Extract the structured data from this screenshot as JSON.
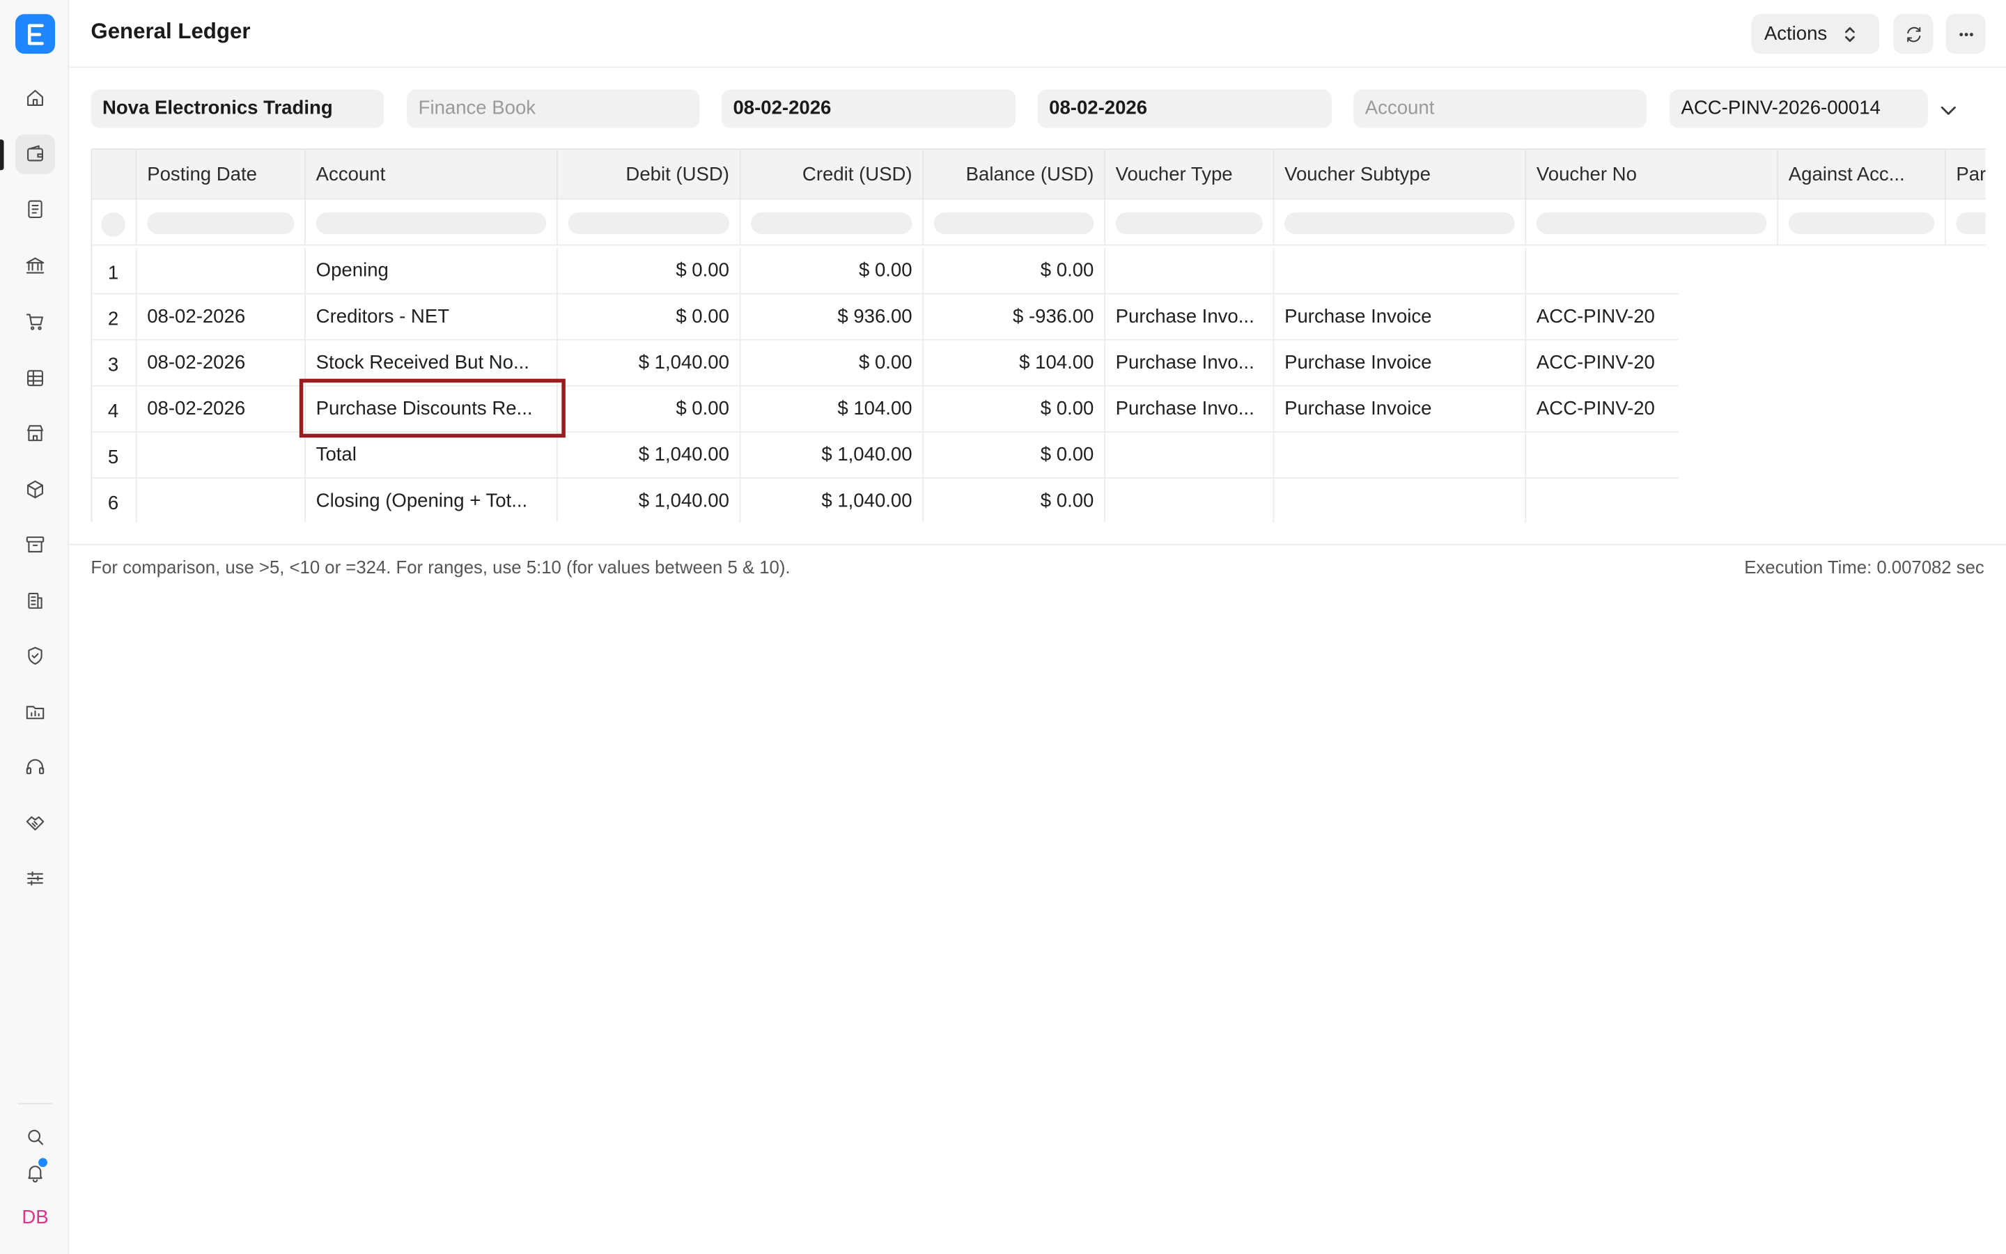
{
  "header": {
    "title": "General Ledger",
    "actions_label": "Actions"
  },
  "filters": {
    "company": "Nova Electronics Trading",
    "finance_book_placeholder": "Finance Book",
    "from_date": "08-02-2026",
    "to_date": "08-02-2026",
    "account_placeholder": "Account",
    "voucher_no": "ACC-PINV-2026-00014"
  },
  "table": {
    "columns": [
      "Posting Date",
      "Account",
      "Debit (USD)",
      "Credit (USD)",
      "Balance (USD)",
      "Voucher Type",
      "Voucher Subtype",
      "Voucher No",
      "Against Acc...",
      "Par"
    ],
    "rows": [
      {
        "idx": "1",
        "posting_date": "",
        "account": "Opening",
        "debit": "$ 0.00",
        "credit": "$ 0.00",
        "balance": "$ 0.00",
        "voucher_type": "",
        "voucher_subtype": "",
        "voucher_no": ""
      },
      {
        "idx": "2",
        "posting_date": "08-02-2026",
        "account": "Creditors - NET",
        "debit": "$ 0.00",
        "credit": "$ 936.00",
        "balance": "$ -936.00",
        "voucher_type": "Purchase Invo...",
        "voucher_subtype": "Purchase Invoice",
        "voucher_no": "ACC-PINV-20"
      },
      {
        "idx": "3",
        "posting_date": "08-02-2026",
        "account": "Stock Received But No...",
        "debit": "$ 1,040.00",
        "credit": "$ 0.00",
        "balance": "$ 104.00",
        "voucher_type": "Purchase Invo...",
        "voucher_subtype": "Purchase Invoice",
        "voucher_no": "ACC-PINV-20"
      },
      {
        "idx": "4",
        "posting_date": "08-02-2026",
        "account": "Purchase Discounts Re...",
        "debit": "$ 0.00",
        "credit": "$ 104.00",
        "balance": "$ 0.00",
        "voucher_type": "Purchase Invo...",
        "voucher_subtype": "Purchase Invoice",
        "voucher_no": "ACC-PINV-20"
      },
      {
        "idx": "5",
        "posting_date": "",
        "account": "Total",
        "debit": "$ 1,040.00",
        "credit": "$ 1,040.00",
        "balance": "$ 0.00",
        "voucher_type": "",
        "voucher_subtype": "",
        "voucher_no": ""
      },
      {
        "idx": "6",
        "posting_date": "",
        "account": "Closing (Opening + Tot...",
        "debit": "$ 1,040.00",
        "credit": "$ 1,040.00",
        "balance": "$ 0.00",
        "voucher_type": "",
        "voucher_subtype": "",
        "voucher_no": ""
      }
    ]
  },
  "footer": {
    "hint": "For comparison, use >5, <10 or =324. For ranges, use 5:10 (for values between 5 & 10).",
    "execution_time": "Execution Time: 0.007082 sec"
  },
  "user": {
    "initials": "DB"
  },
  "colors": {
    "brand": "#1e86ff",
    "highlight_border": "#9b1c1c",
    "avatar_text": "#e0338e"
  },
  "sidebar": {
    "icons": [
      "home-icon",
      "wallet-icon",
      "document-icon",
      "bank-icon",
      "cart-icon",
      "table-icon",
      "store-icon",
      "package-icon",
      "archive-icon",
      "building-icon",
      "shield-icon",
      "folder-chart-icon",
      "headset-icon",
      "handshake-icon",
      "sliders-icon"
    ]
  }
}
